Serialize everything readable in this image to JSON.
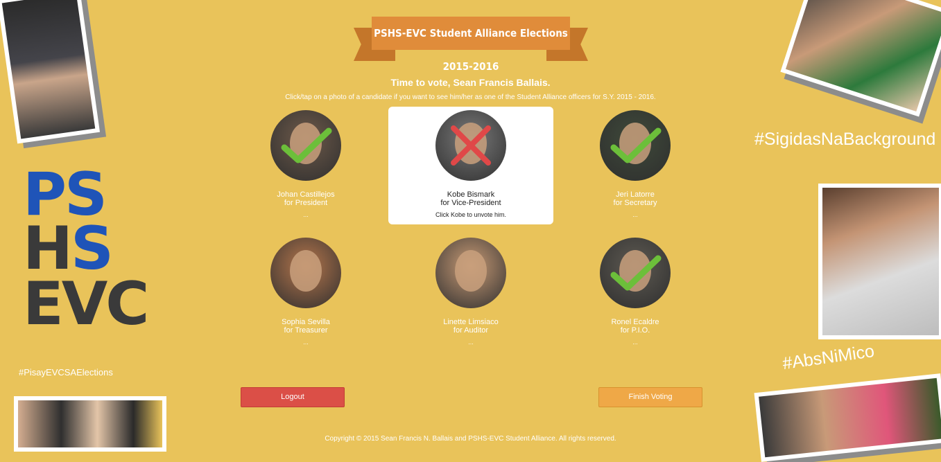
{
  "banner": {
    "title": "PSHS-EVC Student Alliance Elections 2015-2016"
  },
  "greeting": "Time to vote, Sean Francis Ballais.",
  "instruction": "Click/tap on a photo of a candidate if you want to see him/her as one of the Student Alliance officers for S.Y. 2015 - 2016.",
  "branding": {
    "line1": "PS",
    "line2": "HS",
    "line3": "EVC",
    "tag_small": "#PisayEVCSAElections",
    "tag_right_top": "#SigidasNaBackground",
    "tag_right_bottom": "#AbsNiMico"
  },
  "candidates": [
    {
      "name": "Johan Castillejos",
      "role": "for President",
      "note": "...",
      "mark": "check",
      "photo_color": "#6e5a4a"
    },
    {
      "name": "Kobe Bismark",
      "role": "for Vice-President",
      "note": "Click Kobe to unvote him.",
      "mark": "x",
      "photo_color": "#7a7a7a"
    },
    {
      "name": "Jeri Latorre",
      "role": "for Secretary",
      "note": "...",
      "mark": "check",
      "photo_color": "#3f4a3a"
    },
    {
      "name": "Sophia Sevilla",
      "role": "for Treasurer",
      "note": "...",
      "mark": "none",
      "photo_color": "#b5764c"
    },
    {
      "name": "Linette Limsiaco",
      "role": "for Auditor",
      "note": "...",
      "mark": "none",
      "photo_color": "#c79a75"
    },
    {
      "name": "Ronel Ecaldre",
      "role": "for P.I.O.",
      "note": "...",
      "mark": "check",
      "photo_color": "#5e5a52"
    }
  ],
  "buttons": {
    "logout": "Logout",
    "finish": "Finish Voting"
  },
  "footer": "Copyright © 2015 Sean Francis N. Ballais and PSHS-EVC Student Alliance. All rights reserved.",
  "colors": {
    "background": "#e9c35a",
    "check": "#6cbf3a",
    "x": "#e04848",
    "logout": "#db4f47",
    "finish": "#efa847"
  }
}
